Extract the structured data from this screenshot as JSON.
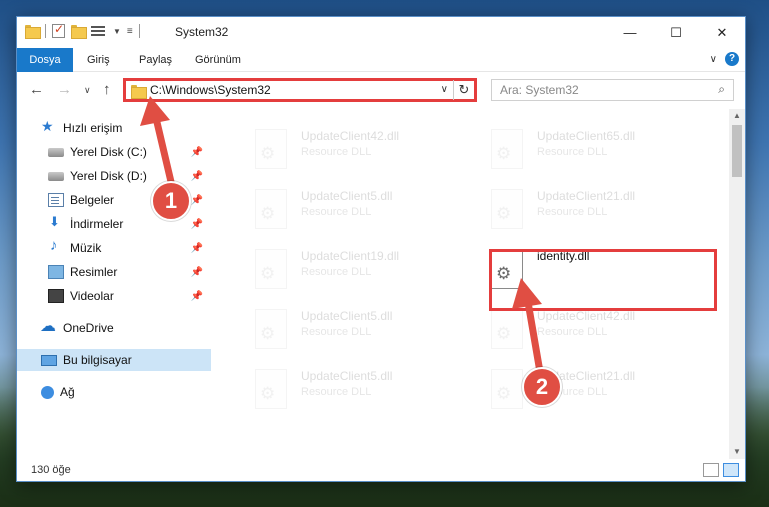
{
  "window": {
    "title": "System32",
    "controls": [
      "minimize-icon",
      "maximize-icon",
      "close-icon"
    ]
  },
  "ribbon": {
    "tabs": [
      {
        "label": "Dosya"
      },
      {
        "label": "Giriş"
      },
      {
        "label": "Paylaş"
      },
      {
        "label": "Görünüm"
      }
    ]
  },
  "address": {
    "path": "C:\\Windows\\System32",
    "search_placeholder": "Ara: System32"
  },
  "sidebar": {
    "items": [
      {
        "label": "Hızlı erişim",
        "icon": "star-icon",
        "pinned": false
      },
      {
        "label": "Yerel Disk (C:)",
        "icon": "disk-icon",
        "pinned": true
      },
      {
        "label": "Yerel Disk (D:)",
        "icon": "disk-icon",
        "pinned": true
      },
      {
        "label": "Belgeler",
        "icon": "documents-icon",
        "pinned": true
      },
      {
        "label": "İndirmeler",
        "icon": "download-icon",
        "pinned": true
      },
      {
        "label": "Müzik",
        "icon": "music-icon",
        "pinned": true
      },
      {
        "label": "Resimler",
        "icon": "pictures-icon",
        "pinned": true
      },
      {
        "label": "Videolar",
        "icon": "videos-icon",
        "pinned": true
      },
      {
        "label": "OneDrive",
        "icon": "cloud-icon",
        "pinned": false
      },
      {
        "label": "Bu bilgisayar",
        "icon": "computer-icon",
        "pinned": false,
        "selected": true
      },
      {
        "label": "Ağ",
        "icon": "network-icon",
        "pinned": false
      }
    ]
  },
  "files": [
    {
      "name": "UpdateClient42.dll",
      "type": "Resource DLL"
    },
    {
      "name": "UpdateClient65.dll",
      "type": "Resource DLL"
    },
    {
      "name": "UpdateClient5.dll",
      "type": "Resource DLL"
    },
    {
      "name": "UpdateClient21.dll",
      "type": "Resource DLL"
    },
    {
      "name": "UpdateClient19.dll",
      "type": "Resource DLL"
    },
    {
      "name": "identity.dll",
      "type": ""
    },
    {
      "name": "UpdateClient5.dll",
      "type": "Resource DLL"
    },
    {
      "name": "UpdateClient42.dll",
      "type": "Resource DLL"
    },
    {
      "name": "UpdateClient5.dll",
      "type": "Resource DLL"
    },
    {
      "name": "UpdateClient21.dll",
      "type": "Resource DLL"
    }
  ],
  "status": {
    "item_count": "130 öğe"
  },
  "annotations": {
    "step1": "1",
    "step2": "2",
    "color": "#e04e43"
  },
  "colors": {
    "accent": "#1979ca",
    "highlight": "#e43d3d",
    "selected_bg": "#cce4f7"
  }
}
